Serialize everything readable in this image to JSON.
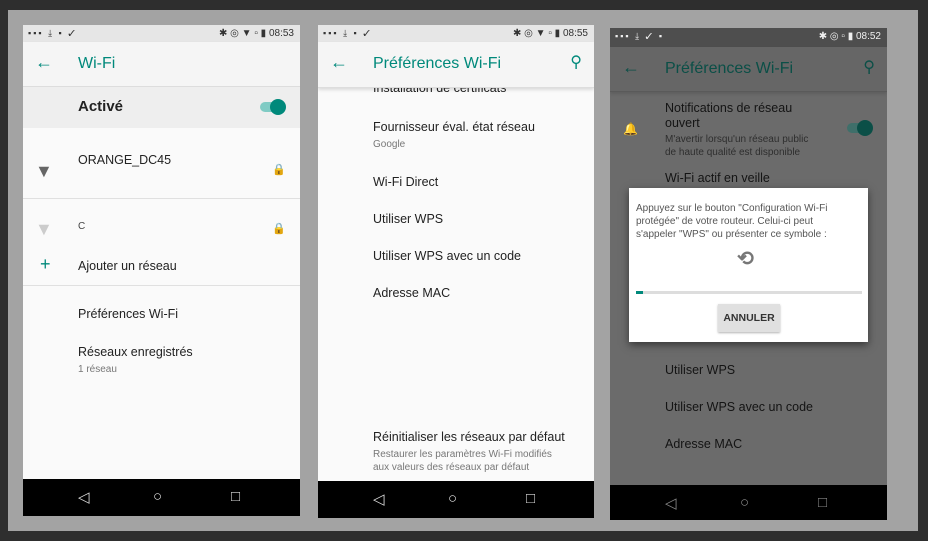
{
  "colors": {
    "accent": "#00897b",
    "background": "#a3a3a3"
  },
  "phone1": {
    "time": "08:53",
    "title": "Wi-Fi",
    "toggle_label": "Activé",
    "toggle_on": true,
    "networks": [
      {
        "name": "ORANGE_DC45",
        "locked": true,
        "signal": "strong"
      },
      {
        "name": "C",
        "locked": true,
        "signal": "weak"
      }
    ],
    "add_network": "Ajouter un réseau",
    "preferences": "Préférences Wi-Fi",
    "saved": "Réseaux enregistrés",
    "saved_sub": "1 réseau"
  },
  "phone2": {
    "time": "08:55",
    "title": "Préférences Wi-Fi",
    "items": [
      {
        "label": "Installation de certificats"
      },
      {
        "label": "Fournisseur éval. état réseau",
        "sub": "Google"
      },
      {
        "label": "Wi-Fi Direct"
      },
      {
        "label": "Utiliser WPS"
      },
      {
        "label": "Utiliser WPS avec un code"
      },
      {
        "label": "Adresse MAC"
      }
    ],
    "reset": "Réinitialiser les réseaux par défaut",
    "reset_sub1": "Restaurer les paramètres Wi-Fi modifiés",
    "reset_sub2": "aux valeurs des réseaux par défaut"
  },
  "phone3": {
    "time": "08:52",
    "title": "Préférences Wi-Fi",
    "notif": "Notifications de réseau",
    "notif2": "ouvert",
    "notif_sub1": "M'avertir lorsqu'un réseau public",
    "notif_sub2": "de haute qualité est disponible",
    "sleep": "Wi-Fi actif en veille",
    "items": [
      "Utiliser WPS",
      "Utiliser WPS avec un code",
      "Adresse MAC"
    ],
    "dialog": {
      "line1": "Appuyez sur le bouton \"Configuration Wi-Fi",
      "line2": "protégée\" de votre routeur. Celui-ci peut",
      "line3": "s'appeler \"WPS\" ou présenter ce symbole :",
      "progress": 0.03,
      "cancel": "ANNULER"
    }
  },
  "nav": {
    "back": "◁",
    "home": "○",
    "recents": "□"
  }
}
